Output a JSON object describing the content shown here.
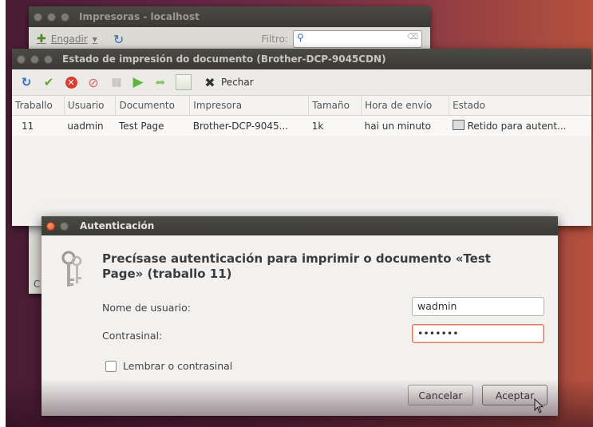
{
  "printers_window": {
    "title": "Impresoras - localhost",
    "add_label": "Engadir",
    "filter_label": "Filtro:",
    "left_edge_label": "C"
  },
  "jobs_window": {
    "title": "Estado de impresión do documento (Brother-DCP-9045CDN)",
    "toolbar": {
      "close_label": "Pechar",
      "icons": [
        "refresh-icon",
        "check-icon",
        "cancel-icon",
        "stop-icon",
        "pause-icon",
        "play-icon",
        "forward-icon",
        "document-icon",
        "close-icon"
      ]
    },
    "columns": [
      "Traballo",
      "Usuario",
      "Documento",
      "Impresora",
      "Tamaño",
      "Hora de envío",
      "Estado"
    ],
    "rows": [
      [
        "11",
        "uadmin",
        "Test Page",
        "Brother-DCP-9045...",
        "1k",
        "hai un minuto",
        "Retido para autent..."
      ]
    ]
  },
  "auth_dialog": {
    "title": "Autenticación",
    "heading": "Precísase autenticación para imprimir o documento «Test Page» (traballo 11)",
    "username_label": "Nome de usuario:",
    "username_value": "wadmin",
    "password_label": "Contrasinal:",
    "password_value": "•••••••",
    "remember_label": "Lembrar o contrasinal",
    "cancel_label": "Cancelar",
    "ok_label": "Aceptar"
  },
  "colors": {
    "accent_close": "#e05423",
    "focus_border": "#e07a5f",
    "titlebar": "#3c3b37"
  }
}
